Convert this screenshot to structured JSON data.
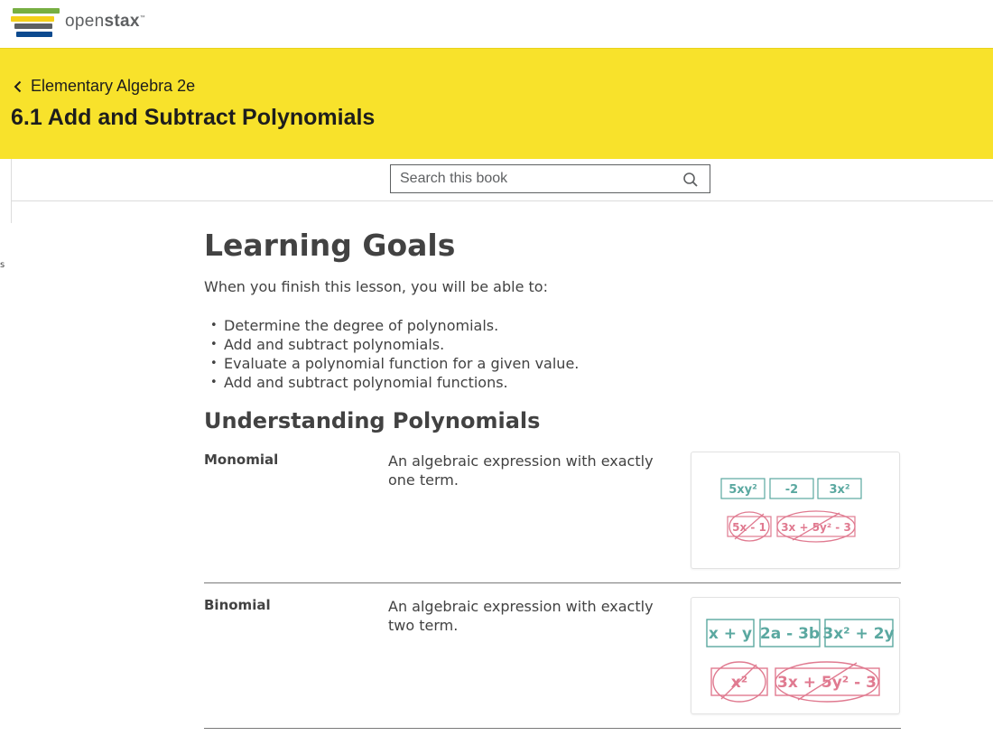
{
  "brand": {
    "logo": "openstax-logo",
    "name_light": "open",
    "name_bold": "stax",
    "tm": "™"
  },
  "book": {
    "back_label": "Elementary Algebra 2e",
    "section_title": "6.1 Add and Subtract Polynomials"
  },
  "search": {
    "placeholder": "Search this book",
    "icon": "search-icon"
  },
  "left_edge_glyph": "s",
  "content": {
    "heading": "Learning Goals",
    "intro": "When you finish this lesson, you will be able to:",
    "goals": [
      "Determine the degree of polynomials.",
      "Add and subtract polynomials.",
      "Evaluate a polynomial function for a given value.",
      "Add and subtract polynomial functions."
    ],
    "subheading": "Understanding Polynomials",
    "terms": [
      {
        "name": "Monomial",
        "definition": "An algebraic expression with exactly one term.",
        "figure": {
          "correct": [
            "5xy²",
            "-2",
            "3x²"
          ],
          "incorrect": [
            "5x - 1",
            "3x + 5y² - 3"
          ]
        }
      },
      {
        "name": "Binomial",
        "definition": "An algebraic expression with exactly two term.",
        "figure": {
          "correct": [
            "x + y",
            "2a - 3b",
            "3x² + 2y"
          ],
          "incorrect": [
            "x²",
            "3x + 5y² - 3"
          ]
        }
      }
    ]
  },
  "colors": {
    "header_yellow": "#f8e22b",
    "text": "#424242",
    "figure_green": "#5aa8a0",
    "figure_red": "#e07a90",
    "logo_green": "#77af42",
    "logo_yellow": "#f4d019",
    "logo_gray": "#5e6062",
    "logo_orange": "#f47641",
    "logo_blue": "#0c9372"
  }
}
